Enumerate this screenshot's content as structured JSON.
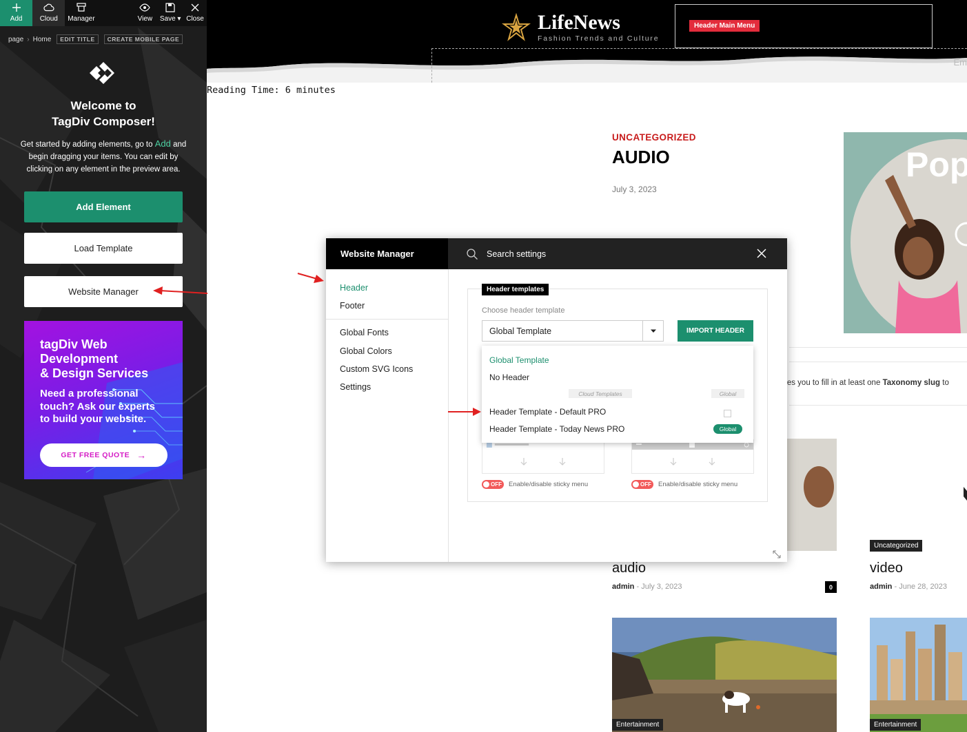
{
  "toolbar": {
    "add": "Add",
    "cloud": "Cloud",
    "manager": "Manager",
    "view": "View",
    "save": "Save",
    "close": "Close"
  },
  "breadcrumb": {
    "page": "page",
    "home": "Home",
    "edit_title": "EDIT TITLE",
    "create_mobile": "CREATE MOBILE PAGE"
  },
  "sidebar": {
    "welcome_line1": "Welcome to",
    "welcome_line2": "TagDiv Composer!",
    "intro_before": "Get started by adding elements, go to",
    "intro_accent": "Add",
    "intro_after": "and begin dragging your items. You can edit by clicking on any element in the preview area.",
    "add_element": "Add Element",
    "load_template": "Load Template",
    "website_manager": "Website Manager"
  },
  "promo": {
    "title_line1": "tagDiv Web",
    "title_line2": "Development",
    "title_line3": "& Design Services",
    "text_line1": "Need a professional",
    "text_line2": "touch? Ask our experts",
    "text_line3": "to build your website.",
    "button": "GET FREE QUOTE",
    "button_arrow": "→"
  },
  "site": {
    "name": "LifeNews",
    "tagline": "Fashion Trends and Culture",
    "menu_badge": "Header Main Menu",
    "cut_text": "Em"
  },
  "article": {
    "reading_time": "Reading Time: 6 minutes",
    "category": "UNCATEGORIZED",
    "title": "AUDIO",
    "date": "July 3, 2023",
    "hero_text": "Pop"
  },
  "taxonomy_message": {
    "before": "res you to fill in at least one",
    "bold": "Taxonomy slug",
    "after": "to"
  },
  "cards": [
    {
      "title": "audio",
      "author": "admin",
      "date": "July 3, 2023",
      "comments": "0"
    },
    {
      "badge": "Uncategorized",
      "title": "video",
      "author": "admin",
      "date": "June 28, 2023"
    },
    {
      "badge": "Entertainment"
    },
    {
      "badge": "Entertainment"
    }
  ],
  "meta_separator": "-",
  "modal": {
    "title": "Website Manager",
    "search_placeholder": "Search settings",
    "nav": [
      "Header",
      "Footer",
      "Global Fonts",
      "Global Colors",
      "Custom SVG Icons",
      "Settings"
    ],
    "panel_tag": "Header templates",
    "choose_label": "Choose header template",
    "selected_template": "Global Template",
    "import_button": "IMPORT HEADER",
    "sticky_toggle": "OFF",
    "sticky_label": "Enable/disable sticky menu",
    "dropdown": {
      "option_global": "Global Template",
      "option_none": "No Header",
      "group_label": "Cloud Templates",
      "global_col": "Global",
      "option_default_pro": "Header Template - Default PRO",
      "option_today_news": "Header Template - Today News PRO",
      "global_badge": "Global"
    }
  },
  "colors": {
    "accent_green": "#1c8f6e",
    "header_black": "#000000",
    "category_red": "#c81c1c",
    "menu_badge_red": "#e32c3c",
    "annotation_arrow_red": "#e02020",
    "promo_purple": "#a312e0"
  }
}
